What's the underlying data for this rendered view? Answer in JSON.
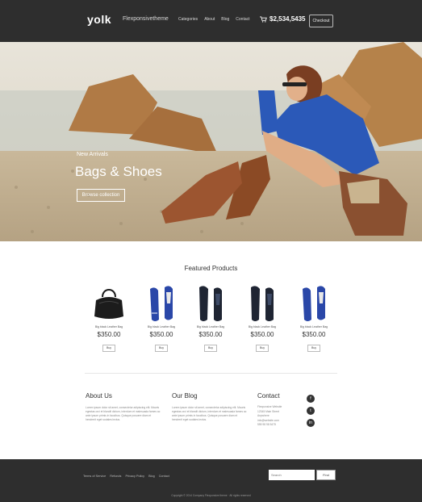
{
  "header": {
    "logo": "yolk",
    "tagline": "Flexponsivetheme",
    "nav": [
      "Categories",
      "About",
      "Blog",
      "Contact"
    ],
    "cart_total": "$2,534,5435",
    "checkout_label": "Checkout"
  },
  "hero": {
    "subtitle": "New Arrivals",
    "title": "Bags & Shoes",
    "button_label": "Browse collection"
  },
  "featured": {
    "title": "Featured Products",
    "products": [
      {
        "name": "Big black Leather Bag",
        "price": "$350.00",
        "buy": "Buy"
      },
      {
        "name": "Big black Leather Bag",
        "price": "$350.00",
        "buy": "Buy"
      },
      {
        "name": "Big black Leather Bag",
        "price": "$350.00",
        "buy": "Buy"
      },
      {
        "name": "Big black Leather Bag",
        "price": "$350.00",
        "buy": "Buy"
      },
      {
        "name": "Big black Leather Bag",
        "price": "$350.00",
        "buy": "Buy"
      }
    ]
  },
  "about": {
    "title": "About Us",
    "text": "Lorem ipsum dolor sit amet, consectetur adipiscing elit. Mauris egestas orci et blandit dictum, interdum et malesuada fames ac ante ipsum primis in faucibus. Quisque posuere diam et hendrerit eget sodales lectus."
  },
  "blog": {
    "title": "Our Blog",
    "text": "Lorem ipsum dolor sit amet, consectetur adipiscing elit. Mauris egestas orci et blandit dictum, interdum et malesuada fames ac ante ipsum primis in faucibus. Quisque posuere diam et hendrerit eget sodales lectus."
  },
  "contact": {
    "title": "Contact",
    "lines": [
      "Flexponsive Website",
      "12345 Main Street",
      "Anywhere",
      "info@website.com",
      "555 98 98 5475"
    ]
  },
  "social": [
    "f",
    "t",
    "in"
  ],
  "footer": {
    "links": [
      "Terms of Service",
      "Refunds",
      "Privacy Policy",
      "Blog",
      "Contact"
    ],
    "copyright": "Copyright © 2014 Company Flexponsive theme · All rights reserved",
    "search_placeholder": "Search",
    "find_label": "Find"
  },
  "colors": {
    "dark_bar": "#2e2e2e",
    "accent_blue": "#2b59b8"
  }
}
